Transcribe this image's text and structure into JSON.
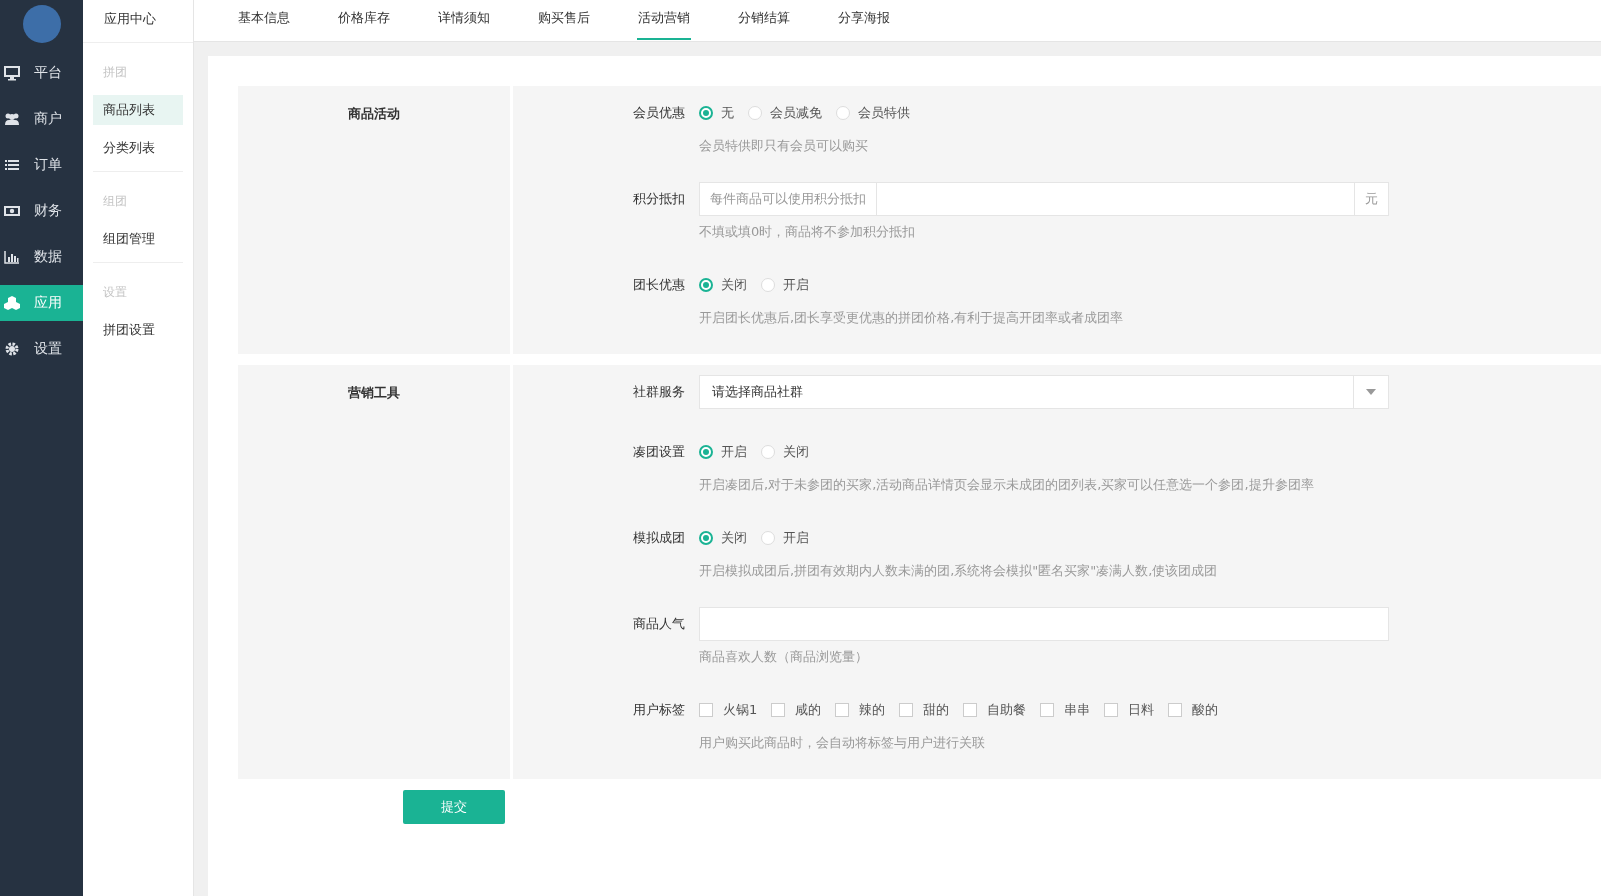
{
  "sidebar": {
    "items": [
      {
        "label": "平台",
        "selected": false
      },
      {
        "label": "商户",
        "selected": false
      },
      {
        "label": "订单",
        "selected": false
      },
      {
        "label": "财务",
        "selected": false
      },
      {
        "label": "数据",
        "selected": false
      },
      {
        "label": "应用",
        "selected": true
      },
      {
        "label": "设置",
        "selected": false
      }
    ]
  },
  "subnav": {
    "title": "应用中心",
    "groups": [
      {
        "heading": "拼团",
        "items": [
          {
            "label": "商品列表",
            "selected": true
          },
          {
            "label": "分类列表",
            "selected": false
          }
        ]
      },
      {
        "heading": "组团",
        "items": [
          {
            "label": "组团管理",
            "selected": false
          }
        ]
      },
      {
        "heading": "设置",
        "items": [
          {
            "label": "拼团设置",
            "selected": false
          }
        ]
      }
    ]
  },
  "tabs": [
    {
      "label": "基本信息",
      "selected": false
    },
    {
      "label": "价格库存",
      "selected": false
    },
    {
      "label": "详情须知",
      "selected": false
    },
    {
      "label": "购买售后",
      "selected": false
    },
    {
      "label": "活动营销",
      "selected": true
    },
    {
      "label": "分销结算",
      "selected": false
    },
    {
      "label": "分享海报",
      "selected": false
    }
  ],
  "sections": [
    {
      "title": "商品活动",
      "fields": [
        {
          "kind": "radio",
          "label": "会员优惠",
          "options": [
            {
              "label": "无",
              "selected": true
            },
            {
              "label": "会员减免",
              "selected": false
            },
            {
              "label": "会员特供",
              "selected": false
            }
          ],
          "help": "会员特供即只有会员可以购买"
        },
        {
          "kind": "addon",
          "label": "积分抵扣",
          "prefix": "每件商品可以使用积分抵扣",
          "suffix": "元",
          "help": "不填或填0时，商品将不参加积分抵扣"
        },
        {
          "kind": "radio",
          "label": "团长优惠",
          "options": [
            {
              "label": "关闭",
              "selected": true
            },
            {
              "label": "开启",
              "selected": false
            }
          ],
          "help": "开启团长优惠后,团长享受更优惠的拼团价格,有利于提高开团率或者成团率"
        }
      ]
    },
    {
      "title": "营销工具",
      "fields": [
        {
          "kind": "select",
          "label": "社群服务",
          "value": "请选择商品社群"
        },
        {
          "kind": "radio",
          "label": "凑团设置",
          "options": [
            {
              "label": "开启",
              "selected": true
            },
            {
              "label": "关闭",
              "selected": false
            }
          ],
          "help": "开启凑团后,对于未参团的买家,活动商品详情页会显示未成团的团列表,买家可以任意选一个参团,提升参团率"
        },
        {
          "kind": "radio",
          "label": "模拟成团",
          "options": [
            {
              "label": "关闭",
              "selected": true
            },
            {
              "label": "开启",
              "selected": false
            }
          ],
          "help": "开启模拟成团后,拼团有效期内人数未满的团,系统将会模拟\"匿名买家\"凑满人数,使该团成团"
        },
        {
          "kind": "text",
          "label": "商品人气",
          "help": "商品喜欢人数（商品浏览量）"
        },
        {
          "kind": "checkbox",
          "label": "用户标签",
          "options": [
            {
              "label": "火锅1",
              "checked": false
            },
            {
              "label": "咸的",
              "checked": false
            },
            {
              "label": "辣的",
              "checked": false
            },
            {
              "label": "甜的",
              "checked": false
            },
            {
              "label": "自助餐",
              "checked": false
            },
            {
              "label": "串串",
              "checked": false
            },
            {
              "label": "日料",
              "checked": false
            },
            {
              "label": "酸的",
              "checked": false
            }
          ],
          "help": "用户购买此商品时，会自动将标签与用户进行关联"
        }
      ]
    }
  ],
  "submit": "提交"
}
